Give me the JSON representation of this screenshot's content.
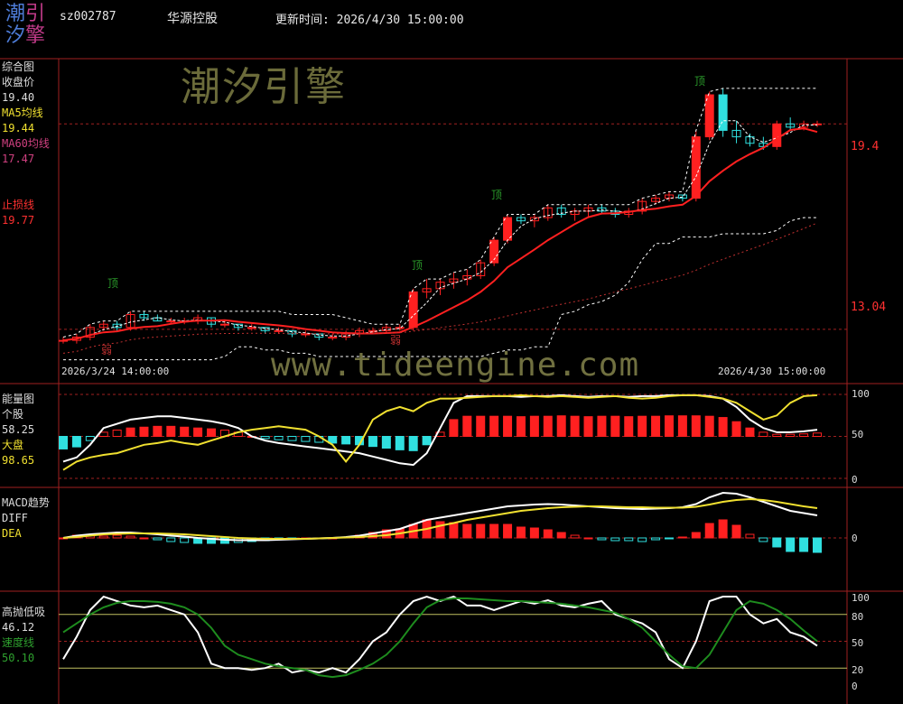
{
  "header": {
    "logo_chars": [
      "潮",
      "引",
      "汐",
      "擎"
    ],
    "stock_code": "sz002787",
    "stock_name": "华源控股",
    "update_label": "更新时间: 2026/4/30 15:00:00"
  },
  "main_panel": {
    "title": "综合图",
    "close_label": "收盘价",
    "close_value": "19.40",
    "ma5_label": "MA5均线",
    "ma5_value": "19.44",
    "ma60_label": "MA60均线",
    "ma60_value": "17.47",
    "stop_label": "止损线",
    "stop_value": "19.77",
    "watermark": "潮汐引擎",
    "date_start": "2026/3/24 14:00:00",
    "date_end": "2026/4/30 15:00:00",
    "price_high_label": "19.4",
    "price_low_label": "13.04",
    "annotations": [
      {
        "text": "顶",
        "color": "#2a9a2a",
        "ax": 125,
        "ay": 318
      },
      {
        "text": "弱",
        "color": "#c03030",
        "ax": 118,
        "ay": 392
      },
      {
        "text": "顶",
        "color": "#2a9a2a",
        "ax": 462,
        "ay": 298
      },
      {
        "text": "弱",
        "color": "#c03030",
        "ax": 438,
        "ay": 381
      },
      {
        "text": "顶",
        "color": "#2a9a2a",
        "ax": 550,
        "ay": 220
      },
      {
        "text": "顶",
        "color": "#2a9a2a",
        "ax": 775,
        "ay": 94
      }
    ]
  },
  "energy_panel": {
    "title": "能量图",
    "stock_label": "个股",
    "stock_value": "58.25",
    "market_label": "大盘",
    "market_value": "98.65",
    "scale": [
      "100",
      "50",
      "0"
    ]
  },
  "macd_panel": {
    "title": "MACD趋势",
    "diff_label": "DIFF",
    "dea_label": "DEA",
    "scale": [
      "0"
    ]
  },
  "kdj_panel": {
    "title": "高抛低吸",
    "value": "46.12",
    "speed_label": "速度线",
    "speed_value": "50.10",
    "scale": [
      "100",
      "80",
      "50",
      "20",
      "0"
    ]
  },
  "url_watermark": "www.tideengine.com",
  "colors": {
    "up": "#ff2020",
    "down": "#30e0e0",
    "ma5": "#ffffff",
    "ma20": "#ff2020",
    "ma60": "#c03030",
    "grid": "#a02020",
    "yellow": "#f0e030",
    "green": "#1e8c1e"
  },
  "chart_data": [
    {
      "type": "candlestick",
      "title": "综合图",
      "x_range": [
        "2026/3/24 14:00:00",
        "2026/4/30 15:00:00"
      ],
      "bars": [
        [
          12.7,
          12.8,
          12.6,
          12.7
        ],
        [
          12.7,
          12.9,
          12.6,
          12.8
        ],
        [
          12.8,
          13.2,
          12.7,
          13.1
        ],
        [
          13.1,
          13.3,
          13.0,
          13.2
        ],
        [
          13.2,
          13.3,
          13.0,
          13.1
        ],
        [
          13.1,
          13.6,
          13.0,
          13.5
        ],
        [
          13.5,
          13.6,
          13.3,
          13.4
        ],
        [
          13.4,
          13.5,
          13.3,
          13.3
        ],
        [
          13.3,
          13.4,
          13.2,
          13.3
        ],
        [
          13.3,
          13.4,
          13.2,
          13.3
        ],
        [
          13.3,
          13.5,
          13.2,
          13.4
        ],
        [
          13.4,
          13.4,
          13.1,
          13.2
        ],
        [
          13.2,
          13.3,
          13.1,
          13.2
        ],
        [
          13.2,
          13.2,
          13.0,
          13.1
        ],
        [
          13.1,
          13.2,
          13.0,
          13.1
        ],
        [
          13.1,
          13.1,
          12.9,
          13.0
        ],
        [
          13.0,
          13.1,
          12.9,
          13.0
        ],
        [
          13.0,
          13.0,
          12.8,
          12.9
        ],
        [
          12.9,
          13.0,
          12.8,
          12.9
        ],
        [
          12.9,
          12.9,
          12.7,
          12.8
        ],
        [
          12.8,
          12.9,
          12.7,
          12.8
        ],
        [
          12.8,
          13.0,
          12.7,
          12.9
        ],
        [
          12.9,
          13.1,
          12.8,
          13.0
        ],
        [
          13.0,
          13.1,
          12.9,
          13.0
        ],
        [
          13.0,
          13.2,
          12.9,
          13.1
        ],
        [
          13.1,
          13.2,
          13.0,
          13.1
        ],
        [
          13.1,
          14.3,
          13.0,
          14.2
        ],
        [
          14.2,
          14.6,
          14.0,
          14.3
        ],
        [
          14.3,
          14.6,
          14.1,
          14.5
        ],
        [
          14.5,
          14.8,
          14.3,
          14.6
        ],
        [
          14.6,
          14.9,
          14.4,
          14.7
        ],
        [
          14.7,
          15.2,
          14.6,
          15.1
        ],
        [
          15.1,
          15.9,
          15.0,
          15.8
        ],
        [
          15.8,
          16.6,
          15.7,
          16.5
        ],
        [
          16.5,
          16.6,
          16.3,
          16.4
        ],
        [
          16.4,
          16.6,
          16.2,
          16.5
        ],
        [
          16.5,
          16.9,
          16.4,
          16.8
        ],
        [
          16.8,
          16.9,
          16.5,
          16.6
        ],
        [
          16.6,
          16.8,
          16.4,
          16.7
        ],
        [
          16.7,
          16.9,
          16.5,
          16.8
        ],
        [
          16.8,
          16.9,
          16.6,
          16.7
        ],
        [
          16.7,
          16.8,
          16.5,
          16.6
        ],
        [
          16.6,
          16.8,
          16.5,
          16.7
        ],
        [
          16.7,
          17.1,
          16.6,
          17.0
        ],
        [
          17.0,
          17.2,
          16.9,
          17.1
        ],
        [
          17.1,
          17.3,
          17.0,
          17.2
        ],
        [
          17.2,
          17.2,
          17.0,
          17.1
        ],
        [
          17.1,
          19.2,
          17.0,
          19.0
        ],
        [
          19.0,
          20.4,
          18.9,
          20.3
        ],
        [
          20.3,
          20.5,
          19.0,
          19.2
        ],
        [
          19.2,
          19.5,
          18.8,
          19.0
        ],
        [
          19.0,
          19.1,
          18.7,
          18.8
        ],
        [
          18.8,
          19.0,
          18.6,
          18.7
        ],
        [
          18.7,
          19.5,
          18.6,
          19.4
        ],
        [
          19.4,
          19.6,
          19.2,
          19.3
        ],
        [
          19.3,
          19.5,
          19.2,
          19.4
        ],
        [
          19.4,
          19.5,
          19.3,
          19.4
        ]
      ],
      "stop_line": 19.77
    },
    {
      "type": "bar",
      "title": "能量图",
      "ylim": [
        0,
        100
      ],
      "series": [
        {
          "name": "个股",
          "values": [
            20,
            25,
            40,
            60,
            65,
            70,
            72,
            74,
            74,
            72,
            70,
            68,
            65,
            60,
            50,
            45,
            42,
            40,
            38,
            36,
            34,
            32,
            30,
            26,
            22,
            18,
            16,
            30,
            60,
            90,
            98,
            98,
            98,
            98,
            97,
            98,
            98,
            99,
            98,
            97,
            98,
            98,
            97,
            98,
            98,
            99,
            99,
            99,
            98,
            95,
            85,
            70,
            60,
            55,
            55,
            56,
            58
          ]
        },
        {
          "name": "大盘",
          "values": [
            10,
            20,
            25,
            28,
            30,
            35,
            40,
            42,
            45,
            42,
            40,
            45,
            50,
            55,
            58,
            60,
            62,
            60,
            58,
            50,
            40,
            20,
            40,
            70,
            80,
            85,
            80,
            90,
            95,
            95,
            96,
            97,
            98,
            98,
            99,
            98,
            97,
            98,
            97,
            96,
            97,
            98,
            96,
            95,
            96,
            98,
            99,
            99,
            97,
            95,
            90,
            80,
            70,
            75,
            90,
            98,
            99
          ]
        }
      ]
    },
    {
      "type": "bar",
      "title": "MACD趋势",
      "series": [
        {
          "name": "DIFF",
          "values": [
            0,
            0.05,
            0.08,
            0.1,
            0.12,
            0.12,
            0.1,
            0.08,
            0.05,
            0.03,
            0.0,
            -0.02,
            -0.04,
            -0.05,
            -0.05,
            -0.05,
            -0.04,
            -0.03,
            -0.02,
            -0.01,
            0.0,
            0.02,
            0.05,
            0.1,
            0.15,
            0.2,
            0.3,
            0.4,
            0.45,
            0.5,
            0.55,
            0.6,
            0.65,
            0.7,
            0.72,
            0.74,
            0.75,
            0.74,
            0.72,
            0.7,
            0.68,
            0.66,
            0.65,
            0.64,
            0.65,
            0.66,
            0.68,
            0.75,
            0.9,
            1.0,
            0.98,
            0.9,
            0.8,
            0.7,
            0.6,
            0.55,
            0.5
          ]
        },
        {
          "name": "DEA",
          "values": [
            0,
            0.02,
            0.05,
            0.08,
            0.09,
            0.1,
            0.1,
            0.1,
            0.09,
            0.08,
            0.06,
            0.04,
            0.02,
            0.0,
            -0.01,
            -0.02,
            -0.02,
            -0.02,
            -0.02,
            -0.01,
            0.0,
            0.01,
            0.02,
            0.04,
            0.06,
            0.1,
            0.15,
            0.2,
            0.27,
            0.33,
            0.4,
            0.45,
            0.5,
            0.55,
            0.6,
            0.63,
            0.66,
            0.68,
            0.69,
            0.7,
            0.7,
            0.69,
            0.68,
            0.68,
            0.67,
            0.67,
            0.67,
            0.69,
            0.74,
            0.8,
            0.84,
            0.86,
            0.84,
            0.8,
            0.75,
            0.7,
            0.66
          ]
        }
      ]
    },
    {
      "type": "line",
      "title": "高抛低吸",
      "ylim": [
        0,
        100
      ],
      "series": [
        {
          "name": "高抛低吸",
          "values": [
            30,
            55,
            85,
            100,
            95,
            90,
            88,
            90,
            85,
            80,
            60,
            25,
            20,
            20,
            18,
            20,
            25,
            15,
            18,
            15,
            20,
            15,
            30,
            50,
            60,
            80,
            95,
            100,
            95,
            100,
            90,
            90,
            85,
            90,
            95,
            92,
            96,
            90,
            88,
            92,
            95,
            80,
            75,
            70,
            60,
            30,
            20,
            50,
            95,
            100,
            100,
            80,
            70,
            75,
            60,
            55,
            45
          ]
        },
        {
          "name": "速度线",
          "values": [
            60,
            70,
            80,
            88,
            93,
            95,
            95,
            94,
            92,
            88,
            80,
            65,
            45,
            35,
            30,
            25,
            22,
            20,
            18,
            12,
            10,
            12,
            18,
            25,
            35,
            50,
            70,
            88,
            96,
            98,
            98,
            97,
            96,
            95,
            95,
            94,
            93,
            92,
            90,
            88,
            85,
            82,
            75,
            65,
            50,
            35,
            22,
            20,
            35,
            60,
            85,
            95,
            92,
            85,
            75,
            62,
            50
          ]
        }
      ]
    }
  ]
}
